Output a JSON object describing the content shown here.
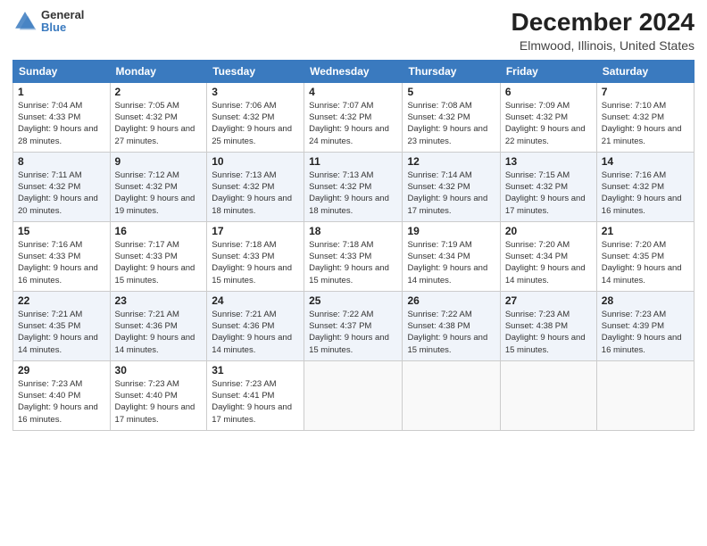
{
  "header": {
    "logo_general": "General",
    "logo_blue": "Blue",
    "title": "December 2024",
    "subtitle": "Elmwood, Illinois, United States"
  },
  "days_of_week": [
    "Sunday",
    "Monday",
    "Tuesday",
    "Wednesday",
    "Thursday",
    "Friday",
    "Saturday"
  ],
  "weeks": [
    [
      {
        "day": 1,
        "sunrise": "Sunrise: 7:04 AM",
        "sunset": "Sunset: 4:33 PM",
        "daylight": "Daylight: 9 hours and 28 minutes."
      },
      {
        "day": 2,
        "sunrise": "Sunrise: 7:05 AM",
        "sunset": "Sunset: 4:32 PM",
        "daylight": "Daylight: 9 hours and 27 minutes."
      },
      {
        "day": 3,
        "sunrise": "Sunrise: 7:06 AM",
        "sunset": "Sunset: 4:32 PM",
        "daylight": "Daylight: 9 hours and 25 minutes."
      },
      {
        "day": 4,
        "sunrise": "Sunrise: 7:07 AM",
        "sunset": "Sunset: 4:32 PM",
        "daylight": "Daylight: 9 hours and 24 minutes."
      },
      {
        "day": 5,
        "sunrise": "Sunrise: 7:08 AM",
        "sunset": "Sunset: 4:32 PM",
        "daylight": "Daylight: 9 hours and 23 minutes."
      },
      {
        "day": 6,
        "sunrise": "Sunrise: 7:09 AM",
        "sunset": "Sunset: 4:32 PM",
        "daylight": "Daylight: 9 hours and 22 minutes."
      },
      {
        "day": 7,
        "sunrise": "Sunrise: 7:10 AM",
        "sunset": "Sunset: 4:32 PM",
        "daylight": "Daylight: 9 hours and 21 minutes."
      }
    ],
    [
      {
        "day": 8,
        "sunrise": "Sunrise: 7:11 AM",
        "sunset": "Sunset: 4:32 PM",
        "daylight": "Daylight: 9 hours and 20 minutes."
      },
      {
        "day": 9,
        "sunrise": "Sunrise: 7:12 AM",
        "sunset": "Sunset: 4:32 PM",
        "daylight": "Daylight: 9 hours and 19 minutes."
      },
      {
        "day": 10,
        "sunrise": "Sunrise: 7:13 AM",
        "sunset": "Sunset: 4:32 PM",
        "daylight": "Daylight: 9 hours and 18 minutes."
      },
      {
        "day": 11,
        "sunrise": "Sunrise: 7:13 AM",
        "sunset": "Sunset: 4:32 PM",
        "daylight": "Daylight: 9 hours and 18 minutes."
      },
      {
        "day": 12,
        "sunrise": "Sunrise: 7:14 AM",
        "sunset": "Sunset: 4:32 PM",
        "daylight": "Daylight: 9 hours and 17 minutes."
      },
      {
        "day": 13,
        "sunrise": "Sunrise: 7:15 AM",
        "sunset": "Sunset: 4:32 PM",
        "daylight": "Daylight: 9 hours and 17 minutes."
      },
      {
        "day": 14,
        "sunrise": "Sunrise: 7:16 AM",
        "sunset": "Sunset: 4:32 PM",
        "daylight": "Daylight: 9 hours and 16 minutes."
      }
    ],
    [
      {
        "day": 15,
        "sunrise": "Sunrise: 7:16 AM",
        "sunset": "Sunset: 4:33 PM",
        "daylight": "Daylight: 9 hours and 16 minutes."
      },
      {
        "day": 16,
        "sunrise": "Sunrise: 7:17 AM",
        "sunset": "Sunset: 4:33 PM",
        "daylight": "Daylight: 9 hours and 15 minutes."
      },
      {
        "day": 17,
        "sunrise": "Sunrise: 7:18 AM",
        "sunset": "Sunset: 4:33 PM",
        "daylight": "Daylight: 9 hours and 15 minutes."
      },
      {
        "day": 18,
        "sunrise": "Sunrise: 7:18 AM",
        "sunset": "Sunset: 4:33 PM",
        "daylight": "Daylight: 9 hours and 15 minutes."
      },
      {
        "day": 19,
        "sunrise": "Sunrise: 7:19 AM",
        "sunset": "Sunset: 4:34 PM",
        "daylight": "Daylight: 9 hours and 14 minutes."
      },
      {
        "day": 20,
        "sunrise": "Sunrise: 7:20 AM",
        "sunset": "Sunset: 4:34 PM",
        "daylight": "Daylight: 9 hours and 14 minutes."
      },
      {
        "day": 21,
        "sunrise": "Sunrise: 7:20 AM",
        "sunset": "Sunset: 4:35 PM",
        "daylight": "Daylight: 9 hours and 14 minutes."
      }
    ],
    [
      {
        "day": 22,
        "sunrise": "Sunrise: 7:21 AM",
        "sunset": "Sunset: 4:35 PM",
        "daylight": "Daylight: 9 hours and 14 minutes."
      },
      {
        "day": 23,
        "sunrise": "Sunrise: 7:21 AM",
        "sunset": "Sunset: 4:36 PM",
        "daylight": "Daylight: 9 hours and 14 minutes."
      },
      {
        "day": 24,
        "sunrise": "Sunrise: 7:21 AM",
        "sunset": "Sunset: 4:36 PM",
        "daylight": "Daylight: 9 hours and 14 minutes."
      },
      {
        "day": 25,
        "sunrise": "Sunrise: 7:22 AM",
        "sunset": "Sunset: 4:37 PM",
        "daylight": "Daylight: 9 hours and 15 minutes."
      },
      {
        "day": 26,
        "sunrise": "Sunrise: 7:22 AM",
        "sunset": "Sunset: 4:38 PM",
        "daylight": "Daylight: 9 hours and 15 minutes."
      },
      {
        "day": 27,
        "sunrise": "Sunrise: 7:23 AM",
        "sunset": "Sunset: 4:38 PM",
        "daylight": "Daylight: 9 hours and 15 minutes."
      },
      {
        "day": 28,
        "sunrise": "Sunrise: 7:23 AM",
        "sunset": "Sunset: 4:39 PM",
        "daylight": "Daylight: 9 hours and 16 minutes."
      }
    ],
    [
      {
        "day": 29,
        "sunrise": "Sunrise: 7:23 AM",
        "sunset": "Sunset: 4:40 PM",
        "daylight": "Daylight: 9 hours and 16 minutes."
      },
      {
        "day": 30,
        "sunrise": "Sunrise: 7:23 AM",
        "sunset": "Sunset: 4:40 PM",
        "daylight": "Daylight: 9 hours and 17 minutes."
      },
      {
        "day": 31,
        "sunrise": "Sunrise: 7:23 AM",
        "sunset": "Sunset: 4:41 PM",
        "daylight": "Daylight: 9 hours and 17 minutes."
      },
      null,
      null,
      null,
      null
    ]
  ]
}
